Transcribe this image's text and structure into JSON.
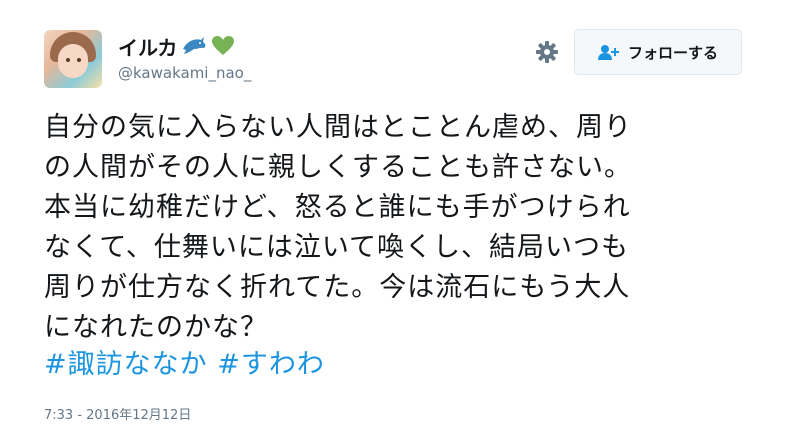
{
  "user": {
    "display_name": "イルカ",
    "handle": "@kawakami_nao_",
    "emoji": [
      "dolphin-icon",
      "green-heart-icon"
    ]
  },
  "actions": {
    "follow_label": "フォローする"
  },
  "tweet": {
    "lines": [
      "自分の気に入らない人間はとことん虐め、周り",
      "の人間がその人に親しくすることも許さない。",
      "本当に幼稚だけど、怒ると誰にも手がつけられ",
      "なくて、仕舞いには泣いて喚くし、結局いつも",
      "周りが仕方なく折れてた。今は流石にもう大人",
      "になれたのかな？"
    ],
    "hashtags": [
      "#諏訪ななか",
      "#すわわ"
    ],
    "timestamp": "7:33 - 2016年12月12日"
  },
  "colors": {
    "link": "#1b95e0",
    "secondary_text": "#657786",
    "heart": "#77b255",
    "dolphin": "#3b88c3"
  }
}
